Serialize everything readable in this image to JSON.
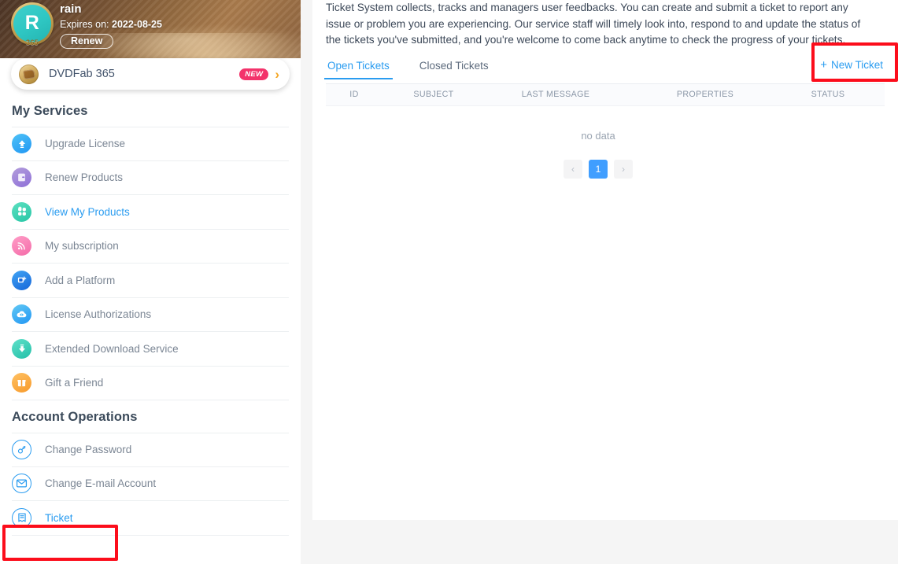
{
  "colors": {
    "accent_blue": "#2a9cf0",
    "pager_blue": "#409eff",
    "highlight_red": "#fc0d1b",
    "new_badge_pink": "#f3336b",
    "panel_bg": "#ffffff",
    "page_bg": "#f5f5f5"
  },
  "sidebar": {
    "profile": {
      "avatar_letter": "R",
      "avatar_badge": "365",
      "name": "rain",
      "expires_label": "Expires on:",
      "expires_date": "2022-08-25",
      "renew_label": "Renew"
    },
    "product_card": {
      "icon": "dvdfab-disc-icon",
      "name": "DVDFab 365",
      "badge": "NEW",
      "chevron": "›"
    },
    "sections": [
      {
        "title": "My Services",
        "items": [
          {
            "label": "Upgrade License",
            "icon": "upgrade-arrow-icon",
            "style": "filled-blue",
            "active": false
          },
          {
            "label": "Renew Products",
            "icon": "renew-box-icon",
            "style": "filled-purple",
            "active": false
          },
          {
            "label": "View My Products",
            "icon": "grid-products-icon",
            "style": "filled-teal",
            "active": true
          },
          {
            "label": "My subscription",
            "icon": "rss-subscription-icon",
            "style": "filled-pink",
            "active": false
          },
          {
            "label": "Add a Platform",
            "icon": "add-platform-icon",
            "style": "filled-blue2",
            "active": false
          },
          {
            "label": "License Authorizations",
            "icon": "cloud-eye-icon",
            "style": "filled-cyan",
            "active": false
          },
          {
            "label": "Extended Download Service",
            "icon": "download-arrow-icon",
            "style": "filled-green",
            "active": false
          },
          {
            "label": "Gift a Friend",
            "icon": "gift-icon",
            "style": "filled-orange",
            "active": false
          }
        ]
      },
      {
        "title": "Account Operations",
        "items": [
          {
            "label": "Change Password",
            "icon": "key-icon",
            "style": "outline-blue",
            "active": false
          },
          {
            "label": "Change E-mail Account",
            "icon": "envelope-icon",
            "style": "outline-blue",
            "active": false
          },
          {
            "label": "Ticket",
            "icon": "ticket-icon",
            "style": "outline-blue",
            "active": true
          }
        ]
      }
    ]
  },
  "main": {
    "intro": "Ticket System collects, tracks and managers user feedbacks. You can create and submit a ticket to report any issue or problem you are experiencing. Our service staff will timely look into, respond to and update the status of the tickets you've submitted, and you're welcome to come back anytime to check the progress of your tickets.",
    "tabs": [
      {
        "label": "Open Tickets",
        "active": true
      },
      {
        "label": "Closed Tickets",
        "active": false
      }
    ],
    "new_ticket": {
      "plus": "+",
      "label": "New Ticket"
    },
    "table": {
      "columns": [
        "ID",
        "SUBJECT",
        "LAST MESSAGE",
        "PROPERTIES",
        "STATUS"
      ],
      "rows": [],
      "empty_text": "no data"
    },
    "pagination": {
      "prev": "‹",
      "next": "›",
      "pages": [
        "1"
      ],
      "current": "1"
    }
  }
}
